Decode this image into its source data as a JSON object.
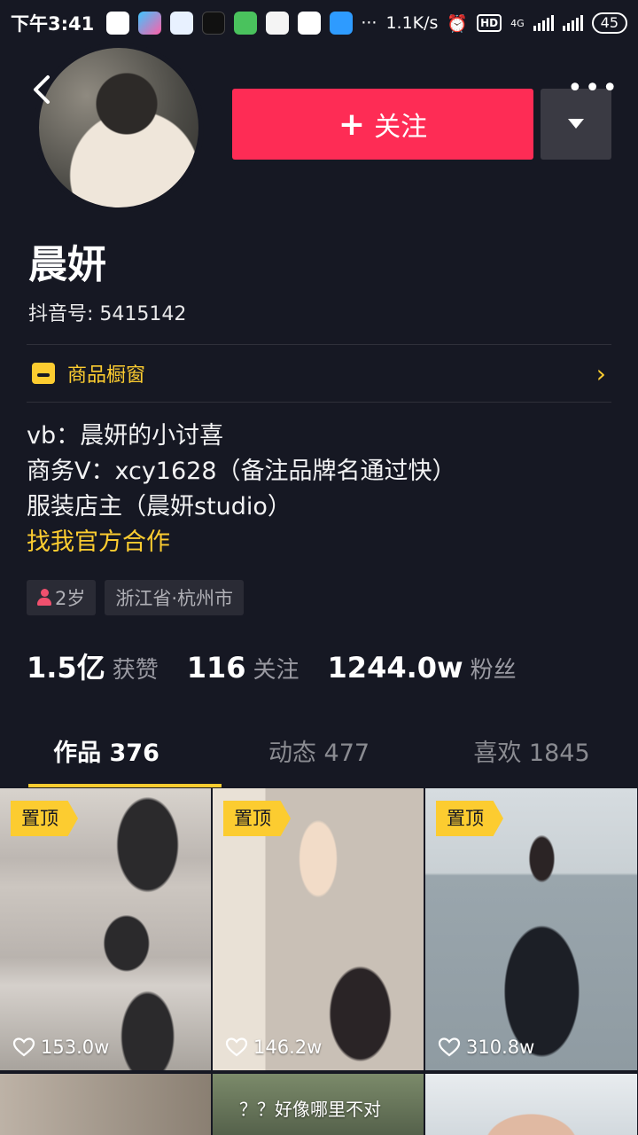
{
  "status_bar": {
    "time": "下午3:41",
    "network_speed": "1.1K/s",
    "hd": "HD",
    "network_type": "4G",
    "battery": "45",
    "more_dots": "···"
  },
  "header": {
    "back_icon": "chevron-left-icon",
    "follow_label": "关注",
    "more_dots": "•••"
  },
  "profile": {
    "name": "晨妍",
    "douyin_id": "抖音号: 5415142"
  },
  "shop": {
    "label": "商品橱窗",
    "arrow": "›"
  },
  "bio": {
    "lines": [
      "vb：晨妍的小讨喜",
      "商务V：xcy1628（备注品牌名通过快）",
      "服装店主（晨妍studio）"
    ],
    "link": "找我官方合作"
  },
  "tags": {
    "age": "2岁",
    "location": "浙江省·杭州市"
  },
  "stats": {
    "likes_value": "1.5亿",
    "likes_label": "获赞",
    "following_value": "116",
    "following_label": "关注",
    "followers_value": "1244.0w",
    "followers_label": "粉丝"
  },
  "tabs": [
    {
      "label": "作品 376",
      "active": true
    },
    {
      "label": "动态 477",
      "active": false
    },
    {
      "label": "喜欢 1845",
      "active": false
    }
  ],
  "videos": [
    {
      "pinned": "置顶",
      "likes": "153.0w"
    },
    {
      "pinned": "置顶",
      "likes": "146.2w"
    },
    {
      "pinned": "置顶",
      "likes": "310.8w"
    },
    {
      "caption": ""
    },
    {
      "caption": "？？好像哪里不对"
    },
    {
      "caption": ""
    }
  ],
  "colors": {
    "background": "#161823",
    "follow_button": "#fe2c55",
    "accent_yellow": "#fccc30"
  }
}
